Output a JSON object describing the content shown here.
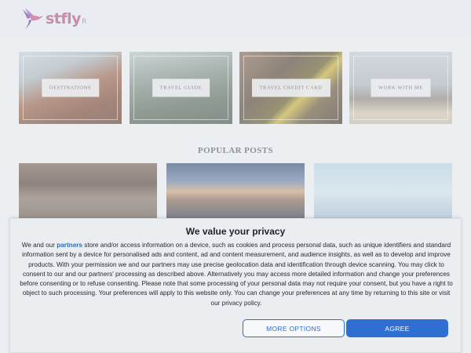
{
  "site": {
    "logo_text": "stfly",
    "logo_suffix": "R"
  },
  "categories": [
    {
      "label": "DESTINATIONS"
    },
    {
      "label": "TRAVEL GUIDE"
    },
    {
      "label": "TRAVEL CREDIT CARD"
    },
    {
      "label": "WORK WITH ME"
    }
  ],
  "popular": {
    "title": "POPULAR POSTS"
  },
  "consent": {
    "title": "We value your privacy",
    "text_before_link": "We and our ",
    "link_label": "partners",
    "text_after_link": " store and/or access information on a device, such as cookies and process personal data, such as unique identifiers and standard information sent by a device for personalised ads and content, ad and content measurement, and audience insights, as well as to develop and improve products. With your permission we and our partners may use precise geolocation data and identification through device scanning. You may click to consent to our and our partners' processing as described above. Alternatively you may access more detailed information and change your preferences before consenting or to refuse consenting. Please note that some processing of your personal data may not require your consent, but you have a right to object to such processing. Your preferences will apply to this website only. You can change your preferences at any time by returning to this site or visit our privacy policy.",
    "more_options_label": "MORE OPTIONS",
    "agree_label": "AGREE"
  },
  "colors": {
    "accent": "#2f6fd2",
    "link": "#2b6cc4",
    "logo": "#b35a86"
  }
}
